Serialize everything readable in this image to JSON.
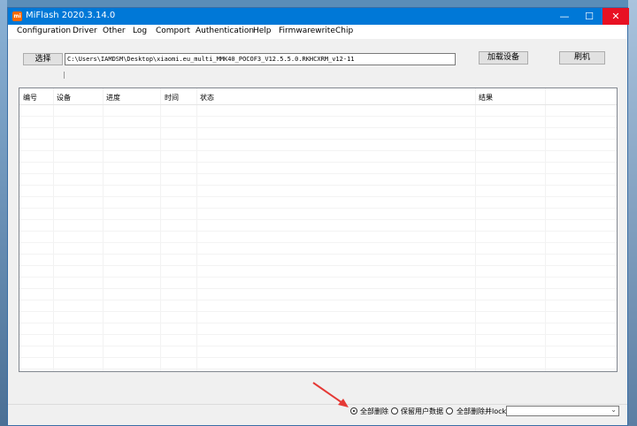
{
  "window": {
    "title": "MiFlash 2020.3.14.0",
    "icon_text": "mi"
  },
  "menubar": {
    "items": [
      "Configuration",
      "Driver",
      "Other",
      "Log",
      "Comport",
      "Authentication",
      "Help",
      "Firmwarewrite",
      "Chip"
    ]
  },
  "toolbar": {
    "select_label": "选择",
    "path_value": "C:\\Users\\IAMDSM\\Desktop\\xiaomi.eu_multi_MMK40_POCOF3_V12.5.5.0.RKHCXRM_v12-11",
    "load_device_label": "加载设备",
    "flash_label": "刷机"
  },
  "table": {
    "columns": [
      "编号",
      "设备",
      "进度",
      "时间",
      "状态",
      "结果"
    ]
  },
  "statusbar": {
    "options": [
      "全部删除",
      "保留用户数据",
      "全部删除并lock"
    ],
    "selected_index": 0,
    "dropdown_value": ""
  },
  "colors": {
    "titlebar": "#0078d7",
    "close": "#e81123",
    "annotation_arrow": "#e53935"
  }
}
